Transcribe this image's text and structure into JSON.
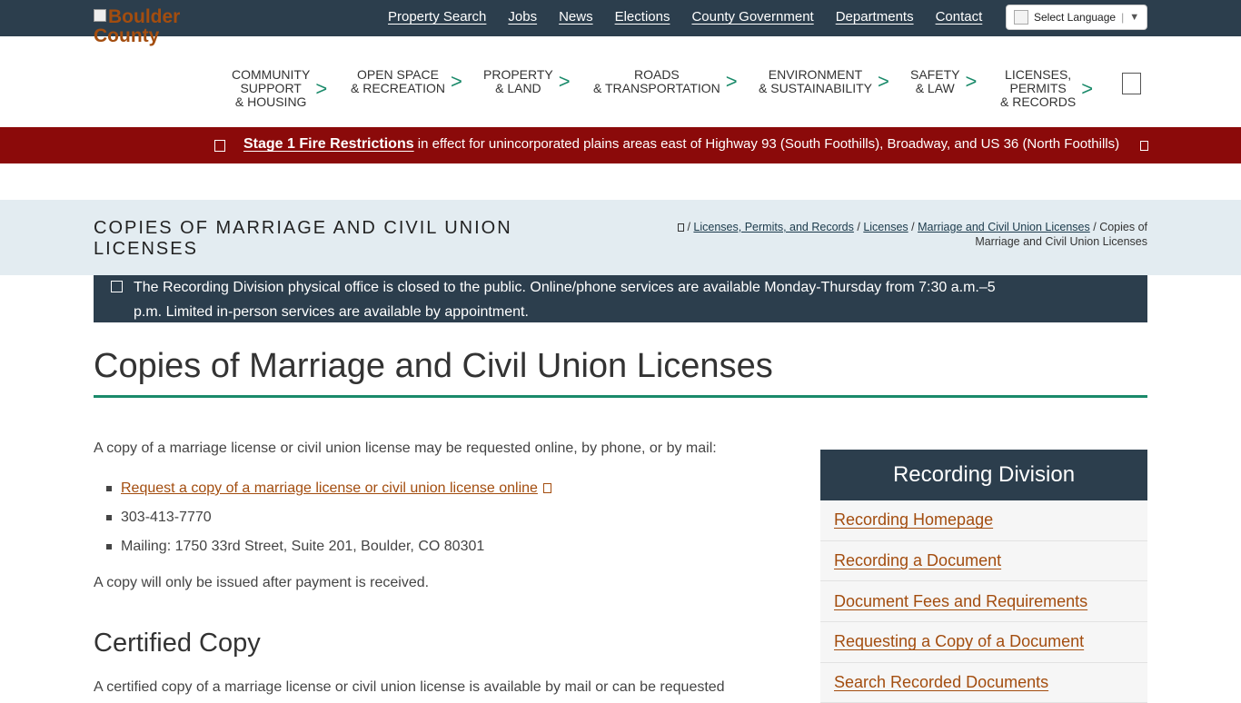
{
  "logo": {
    "text": "Boulder County"
  },
  "top_links": [
    "Property Search",
    "Jobs",
    "News",
    "Elections",
    "County Government",
    "Departments",
    "Contact"
  ],
  "language": {
    "label": "Select Language",
    "arrow": "▼"
  },
  "nav": [
    {
      "l1": "COMMUNITY",
      "l2": "SUPPORT",
      "l3": "& HOUSING"
    },
    {
      "l1": "OPEN SPACE",
      "l2": "& RECREATION",
      "l3": ""
    },
    {
      "l1": "PROPERTY",
      "l2": "& LAND",
      "l3": ""
    },
    {
      "l1": "ROADS",
      "l2": "& TRANSPORTATION",
      "l3": ""
    },
    {
      "l1": "ENVIRONMENT",
      "l2": "& SUSTAINABILITY",
      "l3": ""
    },
    {
      "l1": "SAFETY",
      "l2": "& LAW",
      "l3": ""
    },
    {
      "l1": "LICENSES,",
      "l2": "PERMITS",
      "l3": "& RECORDS"
    }
  ],
  "nav_chevron": ">",
  "alert": {
    "link": "Stage 1 Fire Restrictions",
    "text": " in effect for unincorporated plains areas east of Highway 93 (South Foothills), Broadway, and US 36 (North Foothills)"
  },
  "page_head": "Copies of Marriage and Civil Union Licenses",
  "breadcrumbs": {
    "sep": " / ",
    "items": [
      "Licenses, Permits, and Records",
      "Licenses",
      "Marriage and Civil Union Licenses"
    ],
    "current": "Copies of Marriage and Civil Union Licenses"
  },
  "notice": "The Recording Division physical office is closed to the public. Online/phone services are available Monday-Thursday from 7:30 a.m.–5 p.m. Limited in-person services are available by appointment.",
  "main": {
    "title": "Copies of Marriage and Civil Union Licenses",
    "intro": "A copy of a marriage license or civil union license may be requested online, by phone, or by mail:",
    "list": {
      "link": "Request a copy of a marriage license or civil union license online",
      "phone": "303-413-7770",
      "mail": "Mailing: 1750 33rd Street, Suite 201, Boulder, CO 80301"
    },
    "payment": "A copy will only be issued after payment is received.",
    "h2": "Certified Copy",
    "cut_text": "A certified copy of a marriage license or civil union license is available by mail or can be requested"
  },
  "sidebar": {
    "title": "Recording Division",
    "items": [
      "Recording Homepage",
      "Recording a Document",
      "Document Fees and Requirements",
      "Requesting a Copy of a Document",
      "Search Recorded Documents"
    ]
  },
  "colors": {
    "dark": "#2c3e4d",
    "alert": "#8b0a0a",
    "accent": "#1a8a6a",
    "link": "#a34d0f"
  }
}
